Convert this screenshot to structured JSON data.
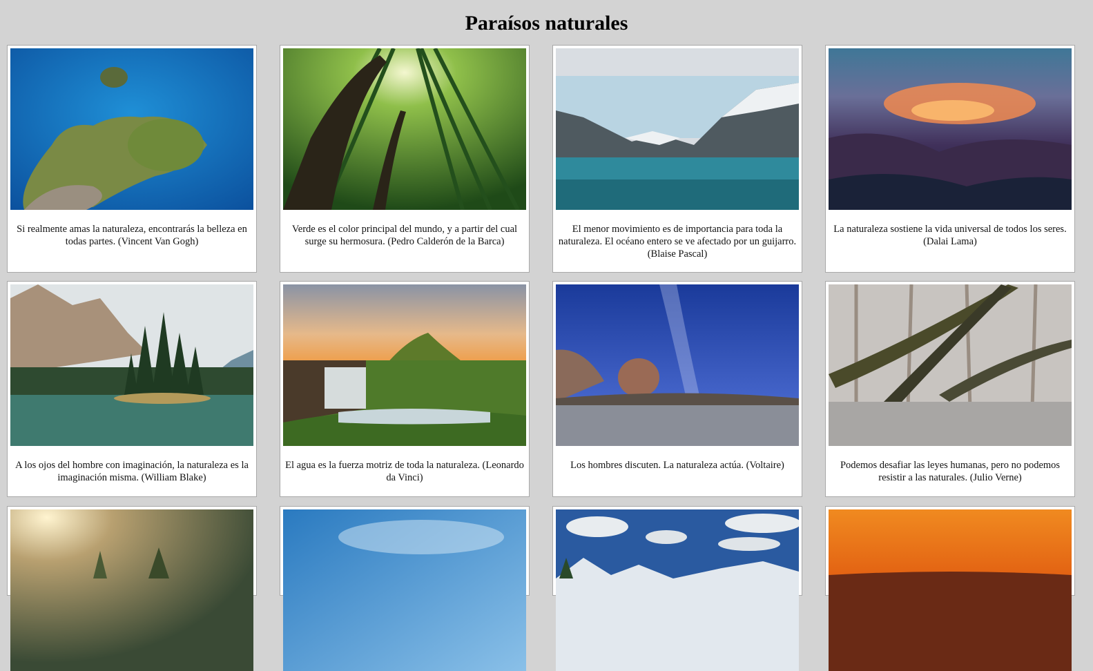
{
  "page": {
    "title": "Paraísos naturales"
  },
  "cards": [
    {
      "caption": "Si realmente amas la naturaleza, encontrarás la belleza en todas partes. (Vincent Van Gogh)",
      "image_icon": "island-aerial-photo"
    },
    {
      "caption": "Verde es el color principal del mundo, y a partir del cual surge su hermosura. (Pedro Calderón de la Barca)",
      "image_icon": "bamboo-forest-photo"
    },
    {
      "caption": "El menor movimiento es de importancia para toda la naturaleza. El océano entero se ve afectado por un guijarro. (Blaise Pascal)",
      "image_icon": "mountain-lake-photo"
    },
    {
      "caption": "La naturaleza sostiene la vida universal de todos los seres. (Dalai Lama)",
      "image_icon": "misty-sunset-valley-photo"
    },
    {
      "caption": "A los ojos del hombre con imaginación, la naturaleza es la imaginación misma. (William Blake)",
      "image_icon": "alpine-lake-island-photo"
    },
    {
      "caption": "El agua es la fuerza motriz de toda la naturaleza. (Leonardo da Vinci)",
      "image_icon": "waterfall-mountain-photo"
    },
    {
      "caption": "Los hombres discuten. La naturaleza actúa. (Voltaire)",
      "image_icon": "desert-night-sky-photo"
    },
    {
      "caption": "Podemos desafiar las leyes humanas, pero no podemos resistir a las naturales. (Julio Verne)",
      "image_icon": "flooded-foggy-forest-photo"
    },
    {
      "caption": "",
      "image_icon": "sunlit-forest-photo"
    },
    {
      "caption": "",
      "image_icon": "blue-sky-photo"
    },
    {
      "caption": "",
      "image_icon": "cloudy-mountains-photo"
    },
    {
      "caption": "",
      "image_icon": "orange-sunset-photo"
    }
  ]
}
